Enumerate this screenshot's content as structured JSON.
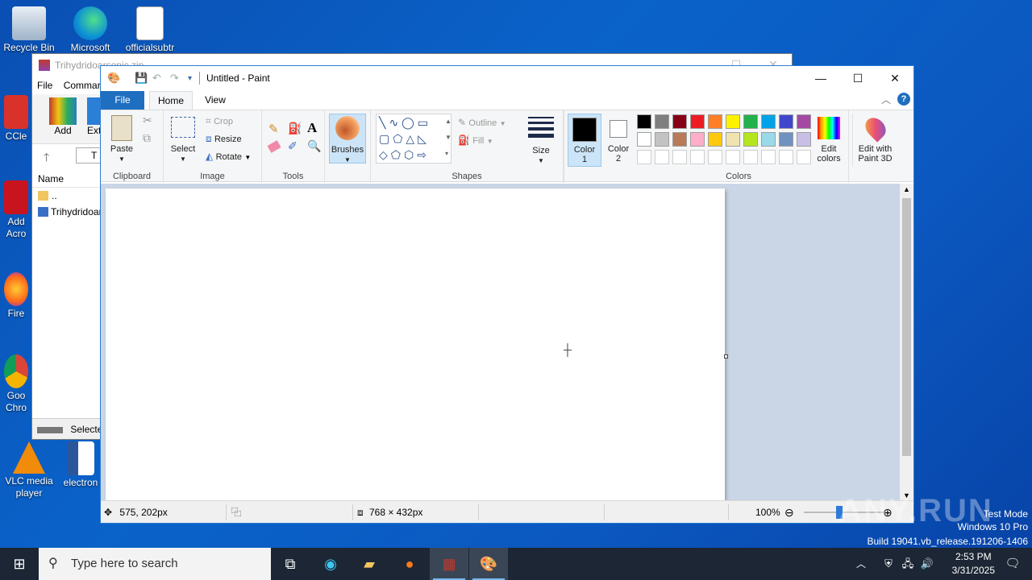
{
  "desktop": {
    "icons": [
      {
        "label": "Recycle Bin"
      },
      {
        "label": "Microsoft"
      },
      {
        "label": "officialsubtr"
      },
      {
        "label": "CCle"
      },
      {
        "label": "Add Acro"
      },
      {
        "label": "Fire"
      },
      {
        "label": "Goo Chro"
      },
      {
        "label": "VLC media player"
      },
      {
        "label": "electron"
      }
    ]
  },
  "winrar": {
    "title": "Trihydridoarsenic.zip",
    "menu": [
      "File",
      "Commar"
    ],
    "toolbar": {
      "add_label": "Add",
      "extract_label": "Ext"
    },
    "path_label": "T",
    "list_header": "Name",
    "rows": [
      "..",
      "Trihydridoar"
    ],
    "status": "Selecte"
  },
  "paint": {
    "title": "Untitled - Paint",
    "tabs": {
      "file": "File",
      "home": "Home",
      "view": "View"
    },
    "clipboard": {
      "paste": "Paste",
      "group": "Clipboard"
    },
    "image": {
      "select": "Select",
      "crop": "Crop",
      "resize": "Resize",
      "rotate": "Rotate",
      "group": "Image"
    },
    "tools": {
      "group": "Tools"
    },
    "brushes": {
      "label": "Brushes"
    },
    "shapes": {
      "outline": "Outline",
      "fill": "Fill",
      "group": "Shapes"
    },
    "size": {
      "label": "Size"
    },
    "color1": {
      "label_a": "Color",
      "label_b": "1",
      "value": "#000000"
    },
    "color2": {
      "label_a": "Color",
      "label_b": "2",
      "value": "#ffffff"
    },
    "colors": {
      "group": "Colors",
      "row1": [
        "#000000",
        "#7f7f7f",
        "#880015",
        "#ed1c24",
        "#ff7f27",
        "#fff200",
        "#22b14c",
        "#00a2e8",
        "#3f48cc",
        "#a349a4"
      ],
      "row2": [
        "#ffffff",
        "#c3c3c3",
        "#b97a57",
        "#ffaec9",
        "#ffc90e",
        "#efe4b0",
        "#b5e61d",
        "#99d9ea",
        "#7092be",
        "#c8bfe7"
      ]
    },
    "edit_colors": {
      "label_a": "Edit",
      "label_b": "colors"
    },
    "paint3d": {
      "label_a": "Edit with",
      "label_b": "Paint 3D"
    },
    "status": {
      "cursor": "575, 202px",
      "canvas_size": "768 × 432px",
      "zoom": "100%"
    }
  },
  "taskbar": {
    "search_placeholder": "Type here to search",
    "time": "2:53 PM",
    "date": "3/31/2025"
  },
  "watermark": {
    "logo": "ANY.RUN",
    "line1": "Test Mode",
    "line2": "Windows 10 Pro",
    "line3": "Build 19041.vb_release.191206-1406"
  }
}
